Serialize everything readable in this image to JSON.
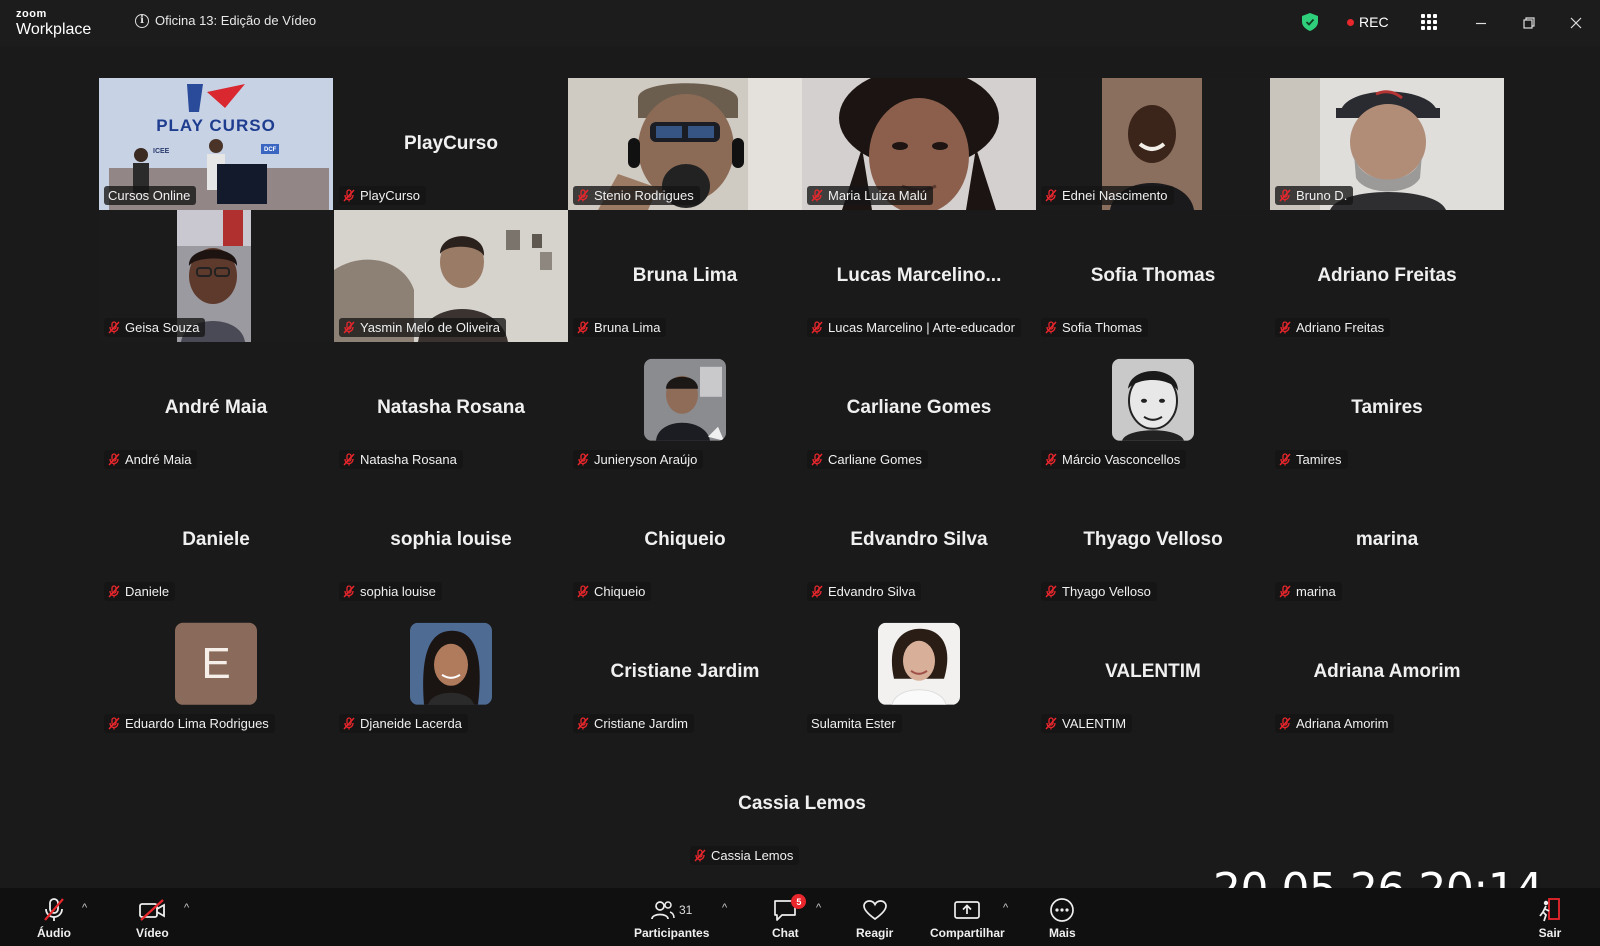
{
  "app": {
    "brand_top": "zoom",
    "brand_bottom": "Workplace",
    "meeting_title": "Oficina 13: Edição de Vídeo",
    "rec_label": "REC"
  },
  "colors": {
    "active_border": "#2fd07b",
    "rec": "#e8262c",
    "muted_mic": "#e8262c",
    "shield": "#2fd07b"
  },
  "tiles": [
    {
      "label": "Cursos Online",
      "big": "",
      "type": "video-playcurso",
      "muted": false
    },
    {
      "label": "PlayCurso",
      "big": "PlayCurso",
      "type": "name",
      "muted": true
    },
    {
      "label": "Stenio Rodrigues",
      "big": "",
      "type": "video-stenio",
      "muted": true
    },
    {
      "label": "Maria Luiza Malú",
      "big": "",
      "type": "video-maria",
      "muted": true
    },
    {
      "label": "Ednei Nascimento",
      "big": "",
      "type": "video-ednei",
      "muted": true
    },
    {
      "label": "Bruno D.",
      "big": "",
      "type": "video-bruno",
      "muted": true
    },
    {
      "label": "Geisa Souza",
      "big": "",
      "type": "video-geisa",
      "muted": true
    },
    {
      "label": "Yasmin Melo de Oliveira",
      "big": "",
      "type": "video-yasmin",
      "muted": true
    },
    {
      "label": "Bruna Lima",
      "big": "Bruna Lima",
      "type": "name",
      "muted": true
    },
    {
      "label": "Lucas Marcelino | Arte-educador",
      "big": "Lucas  Marcelino...",
      "type": "name",
      "muted": true
    },
    {
      "label": "Sofia Thomas",
      "big": "Sofia Thomas",
      "type": "name",
      "muted": true
    },
    {
      "label": "Adriano Freitas",
      "big": "Adriano Freitas",
      "type": "name",
      "muted": true
    },
    {
      "label": "André Maia",
      "big": "André Maia",
      "type": "name",
      "muted": true
    },
    {
      "label": "Natasha Rosana",
      "big": "Natasha Rosana",
      "type": "name",
      "muted": true
    },
    {
      "label": "Junieryson Araújo",
      "big": "",
      "type": "avatar-junieryson",
      "muted": true
    },
    {
      "label": "Carliane Gomes",
      "big": "Carliane Gomes",
      "type": "name",
      "muted": true
    },
    {
      "label": "Márcio Vasconcellos",
      "big": "",
      "type": "avatar-marcio",
      "muted": true
    },
    {
      "label": "Tamires",
      "big": "Tamires",
      "type": "name",
      "muted": true
    },
    {
      "label": "Daniele",
      "big": "Daniele",
      "type": "name",
      "muted": true
    },
    {
      "label": "sophia louise",
      "big": "sophia louise",
      "type": "name",
      "muted": true
    },
    {
      "label": "Chiqueio",
      "big": "Chiqueio",
      "type": "name",
      "muted": true
    },
    {
      "label": "Edvandro Silva",
      "big": "Edvandro Silva",
      "type": "name",
      "muted": true
    },
    {
      "label": "Thyago Velloso",
      "big": "Thyago Velloso",
      "type": "name",
      "muted": true
    },
    {
      "label": "marina",
      "big": "marina",
      "type": "name",
      "muted": true
    },
    {
      "label": "Eduardo Lima Rodrigues",
      "big": "E",
      "type": "avatar-letter",
      "muted": true
    },
    {
      "label": "Djaneide Lacerda",
      "big": "",
      "type": "avatar-djaneide",
      "muted": true
    },
    {
      "label": "Cristiane Jardim",
      "big": "Cristiane Jardim",
      "type": "name",
      "muted": true
    },
    {
      "label": "Sulamita Ester",
      "big": "",
      "type": "avatar-sulamita",
      "muted": false
    },
    {
      "label": "VALENTIM",
      "big": "VALENTIM",
      "type": "name",
      "muted": true
    },
    {
      "label": "Adriana Amorim",
      "big": "Adriana Amorim",
      "type": "name",
      "muted": true
    },
    {
      "label": "Cassia  Lemos",
      "big": "Cassia  Lemos",
      "type": "name",
      "muted": true
    }
  ],
  "playcurso_video": {
    "headline": "PLAY CURSO",
    "badge_left": "ICEE",
    "badge_right": "DCF"
  },
  "toolbar": {
    "audio_label": "Áudio",
    "video_label": "Vídeo",
    "participants_label": "Participantes",
    "participants_count": "31",
    "chat_label": "Chat",
    "chat_badge": "5",
    "react_label": "Reagir",
    "share_label": "Compartilhar",
    "more_label": "Mais",
    "leave_label": "Sair"
  },
  "timestamp": "20.05.26 20:14"
}
